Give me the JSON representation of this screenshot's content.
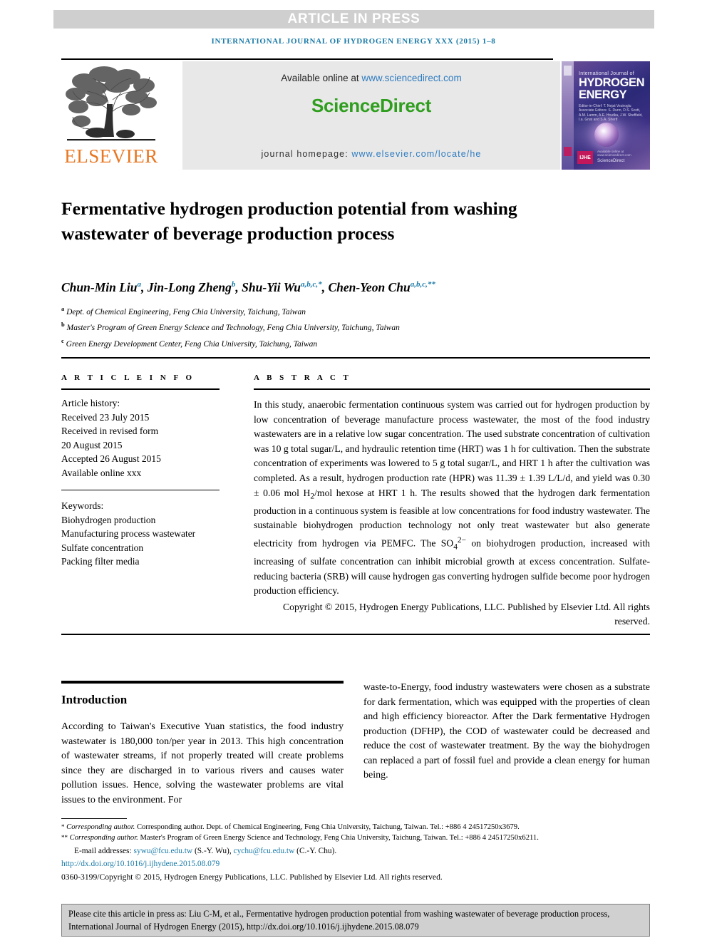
{
  "banner": {
    "press_label": "ARTICLE IN PRESS",
    "running_head": "INTERNATIONAL JOURNAL OF HYDROGEN ENERGY XXX (2015) 1–8"
  },
  "masthead": {
    "publisher_name": "ELSEVIER",
    "available_prefix": "Available online at ",
    "available_url": "www.sciencedirect.com",
    "brand": "ScienceDirect",
    "homepage_prefix": "journal homepage: ",
    "homepage_url": "www.elsevier.com/locate/he",
    "cover": {
      "sub": "International Journal of",
      "line1": "HYDROGEN",
      "line2": "ENERGY",
      "editors": "Editor-in-Chief: T. Nejat Veziroglu\nAssociate Editors: S. Dunn, D.S. Scott, A.M. Lamm, A.E. Hrudka, J.W. Sheffield, I.a. Gnat and S.A. Sherif",
      "badge": "IJHE",
      "sd_small": "ScienceDirect",
      "sd_above": "Available online at www.sciencedirect.com"
    }
  },
  "article": {
    "title": "Fermentative hydrogen production potential from washing wastewater of beverage production process",
    "authors": [
      {
        "name": "Chun-Min Liu",
        "sup": "a"
      },
      {
        "name": "Jin-Long Zheng",
        "sup": "b"
      },
      {
        "name": "Shu-Yii Wu",
        "sup": "a,b,c,*"
      },
      {
        "name": "Chen-Yeon Chu",
        "sup": "a,b,c,**"
      }
    ],
    "affiliations": [
      {
        "marker": "a",
        "text": "Dept. of Chemical Engineering, Feng Chia University, Taichung, Taiwan"
      },
      {
        "marker": "b",
        "text": "Master's Program of Green Energy Science and Technology, Feng Chia University, Taichung, Taiwan"
      },
      {
        "marker": "c",
        "text": "Green Energy Development Center, Feng Chia University, Taichung, Taiwan"
      }
    ]
  },
  "article_info": {
    "label": "A R T I C L E  I N F O",
    "history_label": "Article history:",
    "history": [
      "Received 23 July 2015",
      "Received in revised form",
      "20 August 2015",
      "Accepted 26 August 2015",
      "Available online xxx"
    ],
    "keywords_label": "Keywords:",
    "keywords": [
      "Biohydrogen production",
      "Manufacturing process wastewater",
      "Sulfate concentration",
      "Packing filter media"
    ]
  },
  "abstract": {
    "label": "A B S T R A C T",
    "body_part1": "In this study, anaerobic fermentation continuous system was carried out for hydrogen production by low concentration of beverage manufacture process wastewater, the most of the food industry wastewaters are in a relative low sugar concentration. The used substrate concentration of cultivation was 10 g total sugar/L, and hydraulic retention time (HRT) was 1 h for cultivation. Then the substrate concentration of experiments was lowered to 5 g total sugar/L, and HRT 1 h after the cultivation was completed. As a result, hydrogen production rate (HPR) was 11.39 ± 1.39 L/L/d, and yield was 0.30 ± 0.06 mol H",
    "h2_sub": "2",
    "body_part2": "/mol hexose at HRT 1 h. The results showed that the hydrogen dark fermentation production in a continuous system is feasible at low concentrations for food industry wastewater. The sustainable biohydrogen production technology not only treat wastewater but also generate electricity from hydrogen via PEMFC. The SO",
    "so4_sub": "4",
    "so4_sup": "2−",
    "body_part3": " on biohydrogen production, increased with increasing of sulfate concentration can inhibit microbial growth at excess concentration. Sulfate-reducing bacteria (SRB) will cause hydrogen gas converting hydrogen sulfide become poor hydrogen production efficiency.",
    "copyright": "Copyright © 2015, Hydrogen Energy Publications, LLC. Published by Elsevier Ltd. All rights reserved."
  },
  "introduction": {
    "heading": "Introduction",
    "left_text": "According to Taiwan's Executive Yuan statistics, the food industry wastewater is 180,000 ton/per year in 2013. This high concentration of wastewater streams, if not properly treated will create problems since they are discharged in to various rivers and causes water pollution issues. Hence, solving the wastewater problems are vital issues to the environment. For",
    "right_text": "waste-to-Energy, food industry wastewaters were chosen as a substrate for dark fermentation, which was equipped with the properties of clean and high efficiency bioreactor. After the Dark fermentative Hydrogen production (DFHP), the COD of wastewater could be decreased and reduce the cost of wastewater treatment. By the way the biohydrogen can replaced a part of fossil fuel and provide a clean energy for human being."
  },
  "footnotes": {
    "fn1_marker": "*",
    "fn1": "Corresponding author. Dept. of Chemical Engineering, Feng Chia University, Taichung, Taiwan. Tel.: +886 4 24517250x3679.",
    "fn1_ital": "Corresponding author.",
    "fn2_marker": "**",
    "fn2_ital": "Corresponding author.",
    "fn2": "Master's Program of Green Energy Science and Technology, Feng Chia University, Taichung, Taiwan. Tel.: +886 4 24517250x6211.",
    "email_label": "E-mail addresses:",
    "email1": "sywu@fcu.edu.tw",
    "email1_who": "(S.-Y. Wu),",
    "email2": "cychu@fcu.edu.tw",
    "email2_who": "(C.-Y. Chu).",
    "doi": "http://dx.doi.org/10.1016/j.ijhydene.2015.08.079",
    "issn_line": "0360-3199/Copyright © 2015, Hydrogen Energy Publications, LLC. Published by Elsevier Ltd. All rights reserved."
  },
  "cite_box": {
    "text": "Please cite this article in press as: Liu C-M, et al., Fermentative hydrogen production potential from washing wastewater of beverage production process, International Journal of Hydrogen Energy (2015), http://dx.doi.org/10.1016/j.ijhydene.2015.08.079"
  },
  "colors": {
    "journal_blue": "#1a7aa8",
    "sciencedirect_green": "#2f9e1e",
    "elsevier_orange": "#e87722",
    "banner_gray": "#cfcfcf",
    "cite_gray": "#d0d0d0"
  }
}
